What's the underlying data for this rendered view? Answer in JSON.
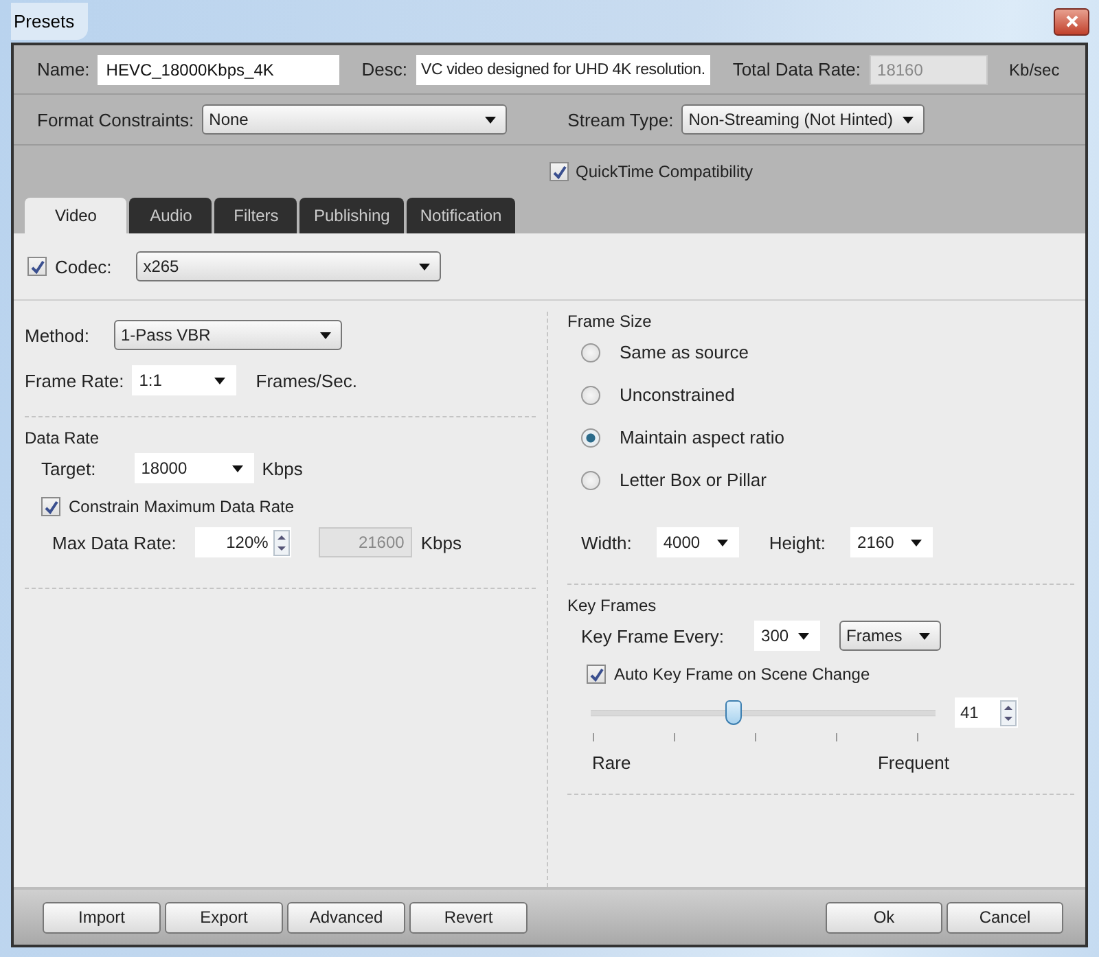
{
  "window": {
    "title": "Presets"
  },
  "header": {
    "name_label": "Name:",
    "name_value": "HEVC_18000Kbps_4K",
    "desc_label": "Desc:",
    "desc_value": "VC video designed for UHD 4K resolution.",
    "total_label": "Total Data Rate:",
    "total_value": "18160",
    "total_unit": "Kb/sec"
  },
  "format_constraints": {
    "label": "Format Constraints:",
    "value": "None"
  },
  "stream_type": {
    "label": "Stream Type:",
    "value": "Non-Streaming (Not Hinted)"
  },
  "quicktime": {
    "label": "QuickTime Compatibility",
    "checked": true
  },
  "tabs": [
    {
      "label": "Video",
      "selected": true
    },
    {
      "label": "Audio",
      "selected": false
    },
    {
      "label": "Filters",
      "selected": false
    },
    {
      "label": "Publishing",
      "selected": false
    },
    {
      "label": "Notification",
      "selected": false
    }
  ],
  "codec": {
    "label": "Codec:",
    "checked": true,
    "value": "x265"
  },
  "method": {
    "label": "Method:",
    "value": "1-Pass VBR"
  },
  "frame_rate": {
    "label": "Frame Rate:",
    "value": "1:1",
    "unit": "Frames/Sec."
  },
  "data_rate": {
    "title": "Data Rate",
    "target_label": "Target:",
    "target_value": "18000",
    "target_unit": "Kbps",
    "constrain": {
      "label": "Constrain Maximum Data Rate",
      "checked": true
    },
    "max_label": "Max Data Rate:",
    "max_percent": "120%",
    "max_value": "21600",
    "max_unit": "Kbps"
  },
  "frame_size": {
    "title": "Frame Size",
    "options": [
      {
        "label": "Same as source",
        "selected": false
      },
      {
        "label": "Unconstrained",
        "selected": false
      },
      {
        "label": "Maintain aspect ratio",
        "selected": true
      },
      {
        "label": "Letter Box or Pillar",
        "selected": false
      }
    ],
    "width_label": "Width:",
    "width_value": "4000",
    "height_label": "Height:",
    "height_value": "2160"
  },
  "key_frames": {
    "title": "Key Frames",
    "every_label": "Key Frame Every:",
    "every_value": "300",
    "every_unit": "Frames",
    "auto": {
      "label": "Auto Key Frame on Scene Change",
      "checked": true
    },
    "slider": {
      "level": 0.41,
      "value": "41",
      "min_label": "Rare",
      "max_label": "Frequent"
    }
  },
  "buttons_left": [
    "Import",
    "Export",
    "Advanced",
    "Revert"
  ],
  "buttons_right": [
    "Ok",
    "Cancel"
  ]
}
